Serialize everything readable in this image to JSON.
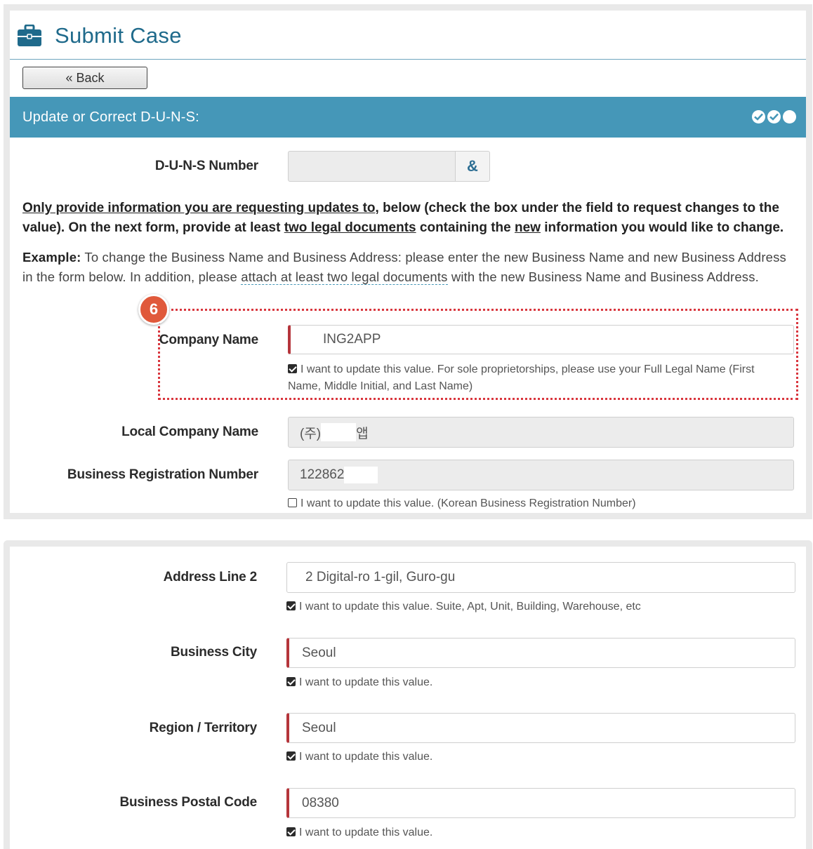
{
  "header": {
    "title": "Submit Case",
    "icon": "briefcase-icon"
  },
  "back_button": {
    "label": "« Back"
  },
  "section": {
    "title": "Update or Correct D-U-N-S:"
  },
  "duns": {
    "label": "D-U-N-S Number",
    "value": "",
    "lookup_glyph": "&"
  },
  "instructions": {
    "part1": "Only provide information you are requesting updates to,",
    "part2": " below (check the box under the field to request changes to the value). On the next form, provide at least ",
    "part3": "two legal documents",
    "part4": " containing the ",
    "part5": "new",
    "part6": " information you would like to change."
  },
  "example": {
    "label": "Example:",
    "text1": " To change the Business Name and Business Address: please enter the new Business Name and new Business Address in the form below.  In addition, please ",
    "link": "attach at least two legal documents",
    "text2": "  with the new Business Name and Business Address."
  },
  "badge": "6",
  "company_name": {
    "label": "Company Name",
    "value": "ING2APP",
    "check_text": "I want to update this value. For sole proprietorships, please use your Full Legal Name (First Name, Middle Initial, and Last Name)",
    "checked": true
  },
  "local_company_name": {
    "label": "Local Company Name",
    "value_prefix": "(주)",
    "value_suffix": "앱"
  },
  "business_registration": {
    "label": "Business Registration Number",
    "value": "122862",
    "check_text": "I want to update this value. (Korean Business Registration Number)",
    "checked": false
  },
  "address_line2": {
    "label": "Address Line 2",
    "value": "2 Digital-ro   1-gil, Guro-gu",
    "check_text": "I want to update this value. Suite, Apt, Unit, Building, Warehouse, etc",
    "checked": true
  },
  "business_city": {
    "label": "Business City",
    "value": "Seoul",
    "check_text": "I want to update this value.",
    "checked": true
  },
  "region": {
    "label": "Region / Territory",
    "value": "Seoul",
    "check_text": "I want to update this value.",
    "checked": true
  },
  "postal_code": {
    "label": "Business Postal Code",
    "value": "08380",
    "check_text": "I want to update this value.",
    "checked": true
  },
  "colors": {
    "accent": "#4597b8",
    "title": "#1f6a8b",
    "required": "#b5353b",
    "badge": "#e0593b",
    "highlight": "#d9363e"
  }
}
